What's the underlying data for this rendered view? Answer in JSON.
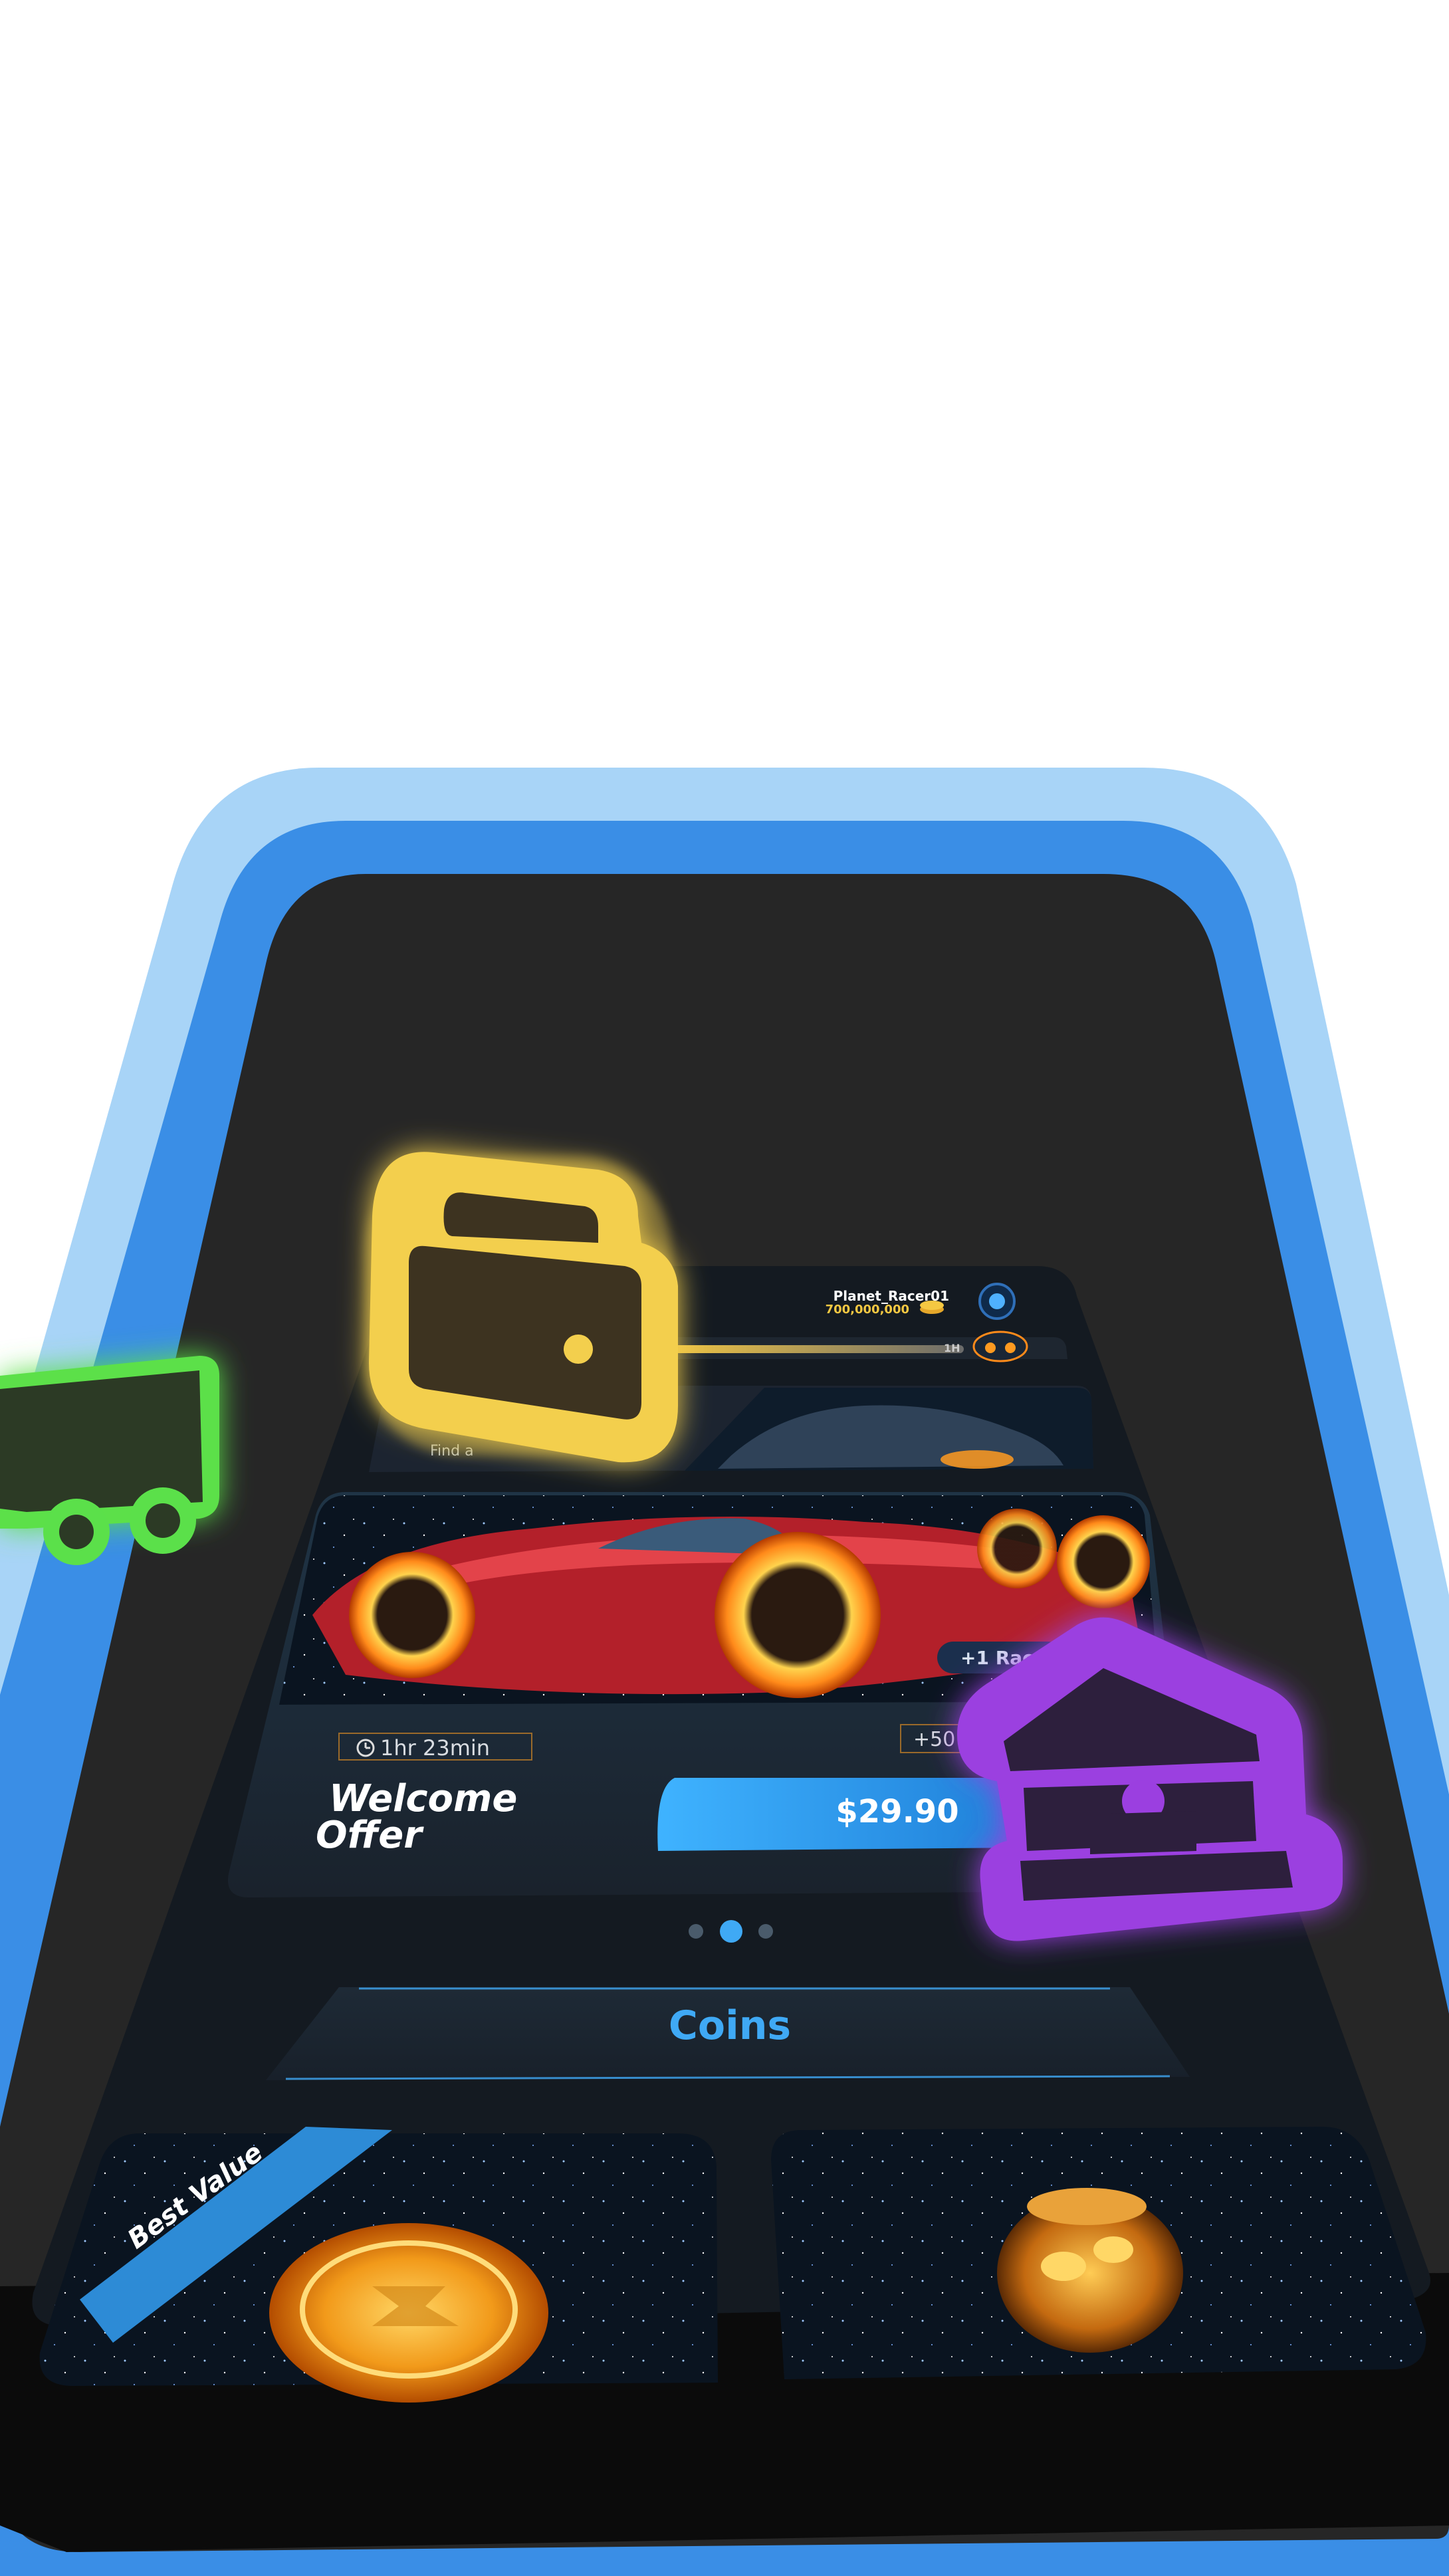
{
  "colors": {
    "frame_outer": "#a8d4f7",
    "frame_inner": "#3a8ee6",
    "screen_bg": "#262626",
    "card_bg": "#1d232b",
    "accent_blue": "#3fa9f5",
    "gold": "#f5c842",
    "wallet_yellow": "#f3cf4d",
    "cart_green": "#5be04a",
    "bank_purple": "#9b3fe0"
  },
  "header": {
    "username": "Planet_Racer01",
    "coins": "700,000,000",
    "progress_label": "1H",
    "avatar_icon": "planet-avatar-icon",
    "coin_icon": "coin-stack-icon"
  },
  "banner_top": {
    "caption": "Find a"
  },
  "welcome_offer": {
    "timer": "1hr 23min",
    "timer_icon": "clock-icon",
    "title_line1": "Welcome",
    "title_line2": "Offer",
    "price": "$29.90",
    "bonus_tag": "+50",
    "racer_tag": "+1 Rac"
  },
  "carousel": {
    "count": 3,
    "active_index": 1
  },
  "coins_section": {
    "title": "Coins",
    "best_value_label": "Best Value"
  },
  "floating_icons": {
    "wallet": "wallet-icon",
    "cart": "shopping-cart-icon",
    "bank": "bank-icon"
  }
}
